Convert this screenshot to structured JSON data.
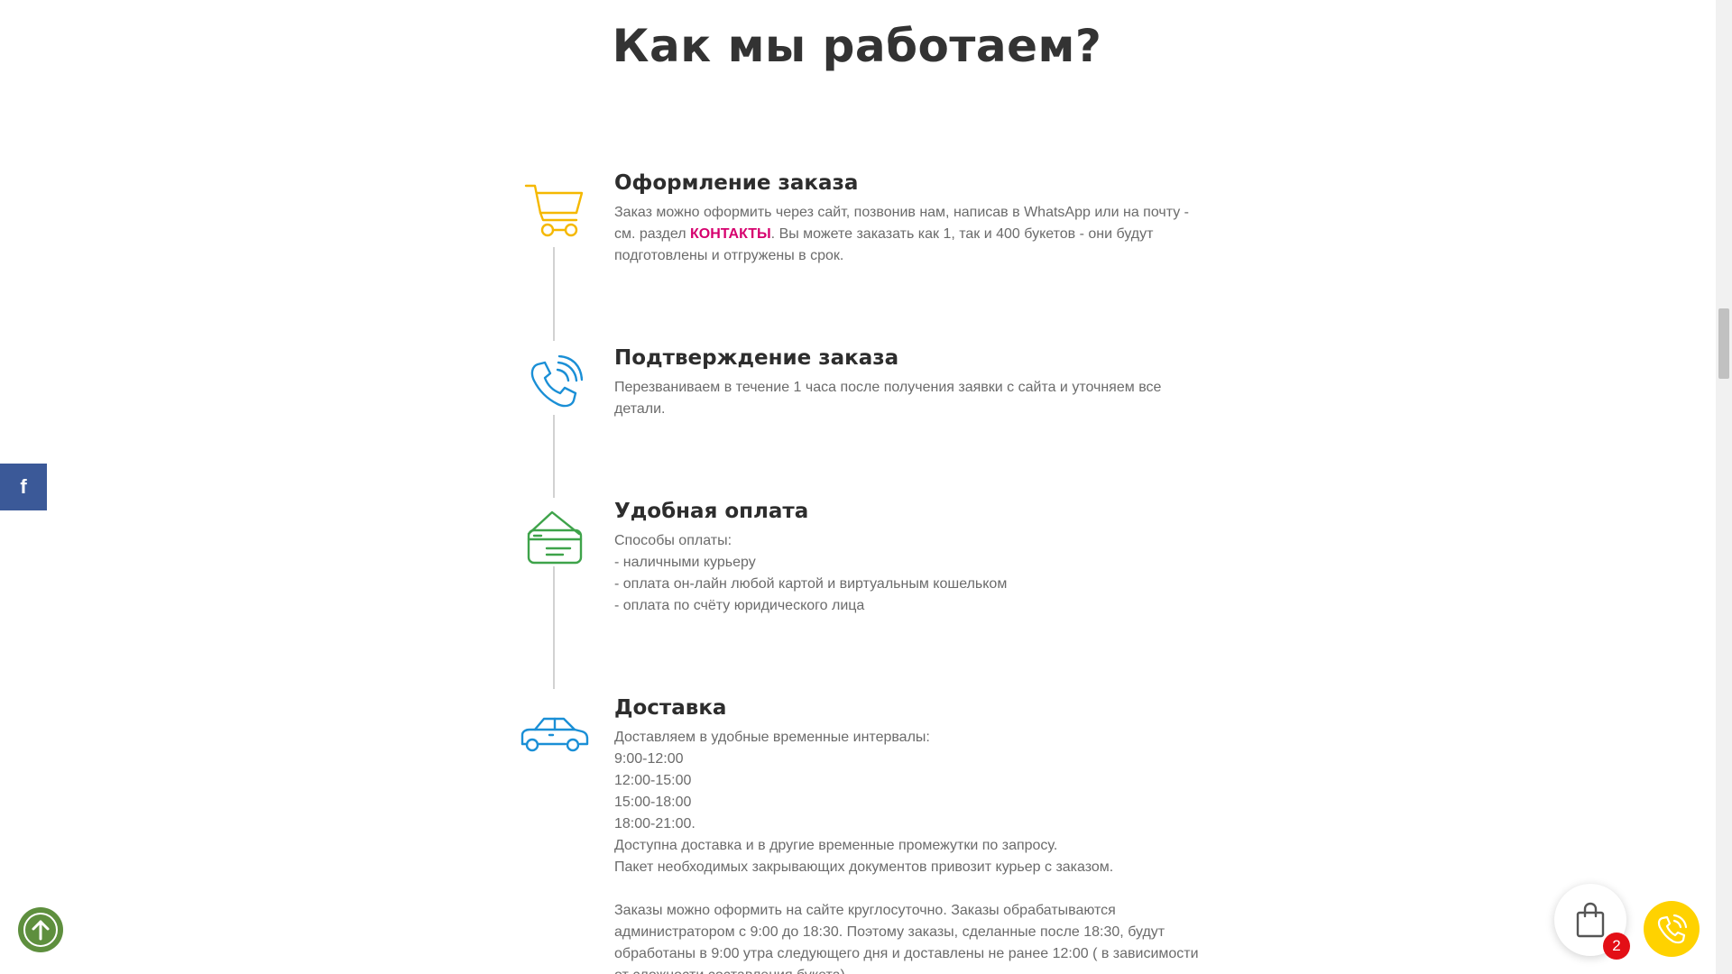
{
  "page": {
    "heading": "Как мы работаем?"
  },
  "steps": [
    {
      "icon": "cart-icon",
      "color": "#f5b800",
      "title": "Оформление заказа",
      "text_lines": [
        "Заказ можно оформить через сайт, позвонив нам, написав в WhatsApp или на почту -",
        "см. раздел "
      ],
      "link_text": "КОНТАКТЫ",
      "after_link": ". Вы можете заказать как 1, так и 400 букетов - они будут",
      "text_tail": "подготовлены и отгружены в срок."
    },
    {
      "icon": "phone-icon",
      "color": "#1a8fd6",
      "title": "Подтверждение заказа",
      "text_lines": [
        "Перезваниваем в течение 1 часа после получения заявки с сайта и уточняем все",
        "детали."
      ]
    },
    {
      "icon": "payment-card-icon",
      "color": "#3ea34a",
      "title": "Удобная оплата",
      "text_lines": [
        "Способы оплаты:",
        "- наличными курьеру",
        "- оплата он-лайн любой картой и виртуальным кошельком",
        "- оплата по счёту юридического лица"
      ]
    },
    {
      "icon": "car-icon",
      "color": "#1a8fd6",
      "title": "Доставка",
      "text_lines": [
        "Доставляем в удобные временные интервалы:",
        "9:00-12:00",
        "12:00-15:00",
        "15:00-18:00",
        "18:00-21:00.",
        "Доступна доставка и в другие временные промежутки по запросу.",
        "Пакет необходимых закрывающих документов привозит курьер с заказом."
      ],
      "text_lines_2": [
        "Заказы можно оформить на сайте круглосуточно. Заказы обрабатываются",
        "администратором с 9:00 до 18:30. Поэтому заказы, сделанные после 18:30, будут",
        "обработаны в 9:00 утра следующего дня и доставлены не ранее 12:00 ( в зависимости",
        "от сложности составления букета)."
      ]
    }
  ],
  "social": {
    "facebook_label": "f"
  },
  "cart": {
    "count": "2"
  },
  "colors": {
    "link": "#d6006e",
    "facebook": "#3b5998",
    "scroll_up": "#5e8f3e",
    "call": "#ffd200",
    "badge": "#e30f16"
  }
}
